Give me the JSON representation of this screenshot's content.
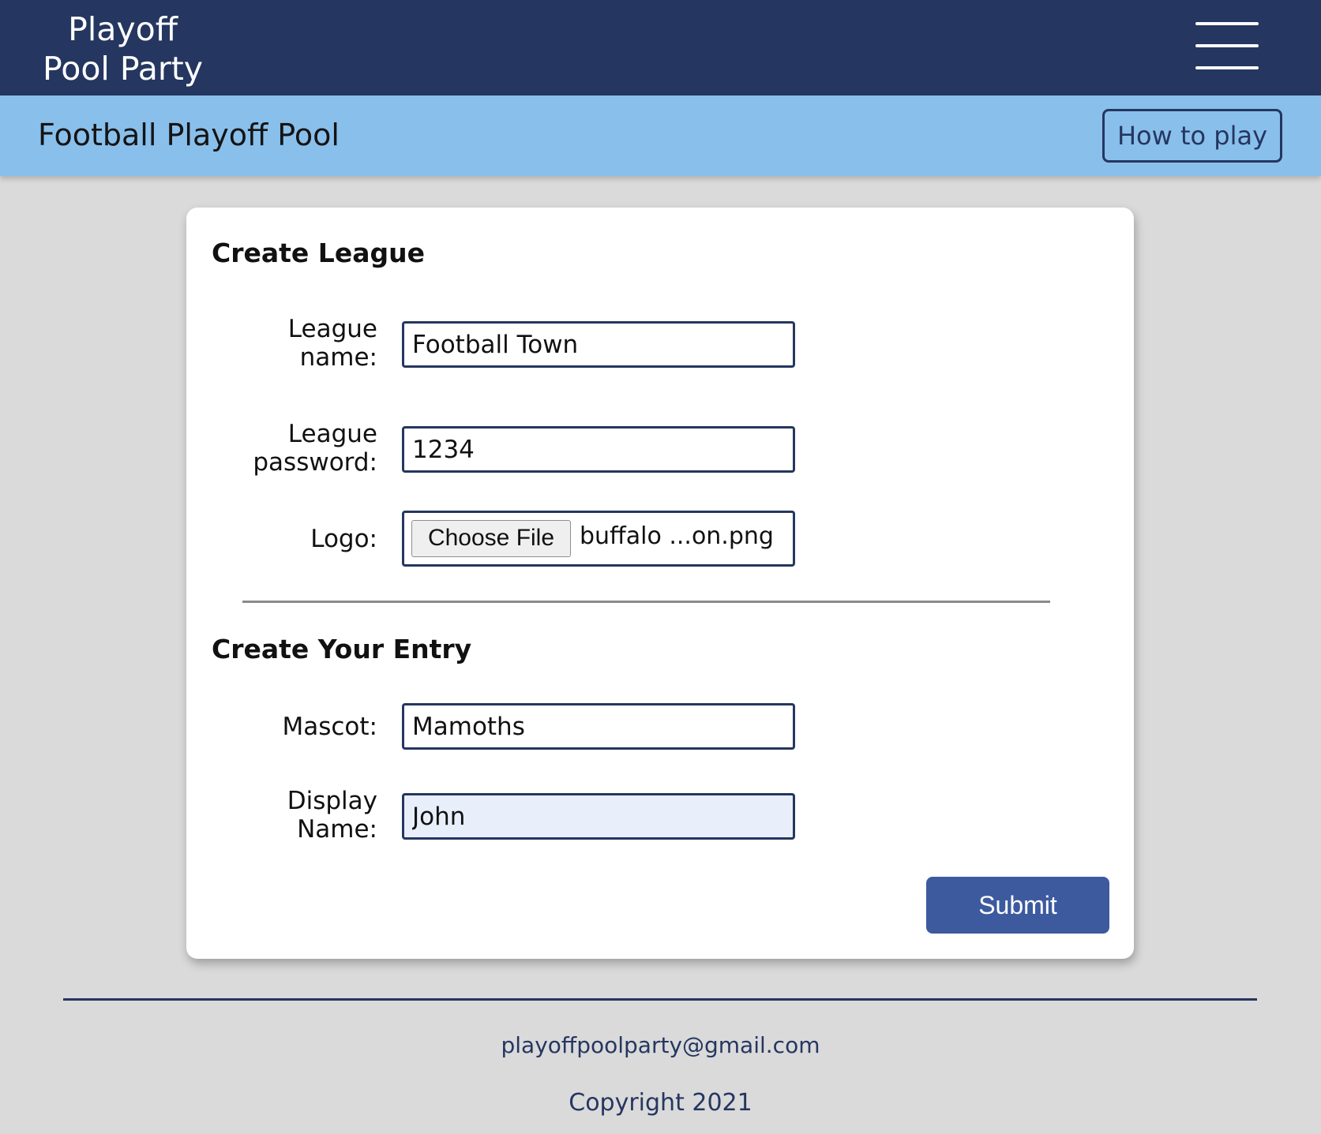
{
  "nav": {
    "brand_line1": "Playoff",
    "brand_line2": "Pool Party",
    "menu_icon": "hamburger-menu-icon"
  },
  "header": {
    "title": "Football Playoff Pool",
    "how_to_play_label": "How to play"
  },
  "create_league": {
    "heading": "Create League",
    "league_name_label_line1": "League",
    "league_name_label_line2": "name:",
    "league_name_value": "Football Town",
    "league_password_label_line1": "League",
    "league_password_label_line2": "password:",
    "league_password_value": "1234",
    "logo_label": "Logo:",
    "choose_file_label": "Choose File",
    "file_name": "buffalo ...on.png"
  },
  "create_entry": {
    "heading": "Create Your Entry",
    "mascot_label": "Mascot:",
    "mascot_value": "Mamoths",
    "display_name_label_line1": "Display",
    "display_name_label_line2": "Name:",
    "display_name_value": "John"
  },
  "submit_label": "Submit",
  "footer": {
    "email": "playoffpoolparty@gmail.com",
    "copyright": "Copyright 2021"
  },
  "colors": {
    "nav_bg": "#253660",
    "subheader_bg": "#89bfeb",
    "submit_bg": "#3d5a9f",
    "page_bg": "#dadada"
  }
}
